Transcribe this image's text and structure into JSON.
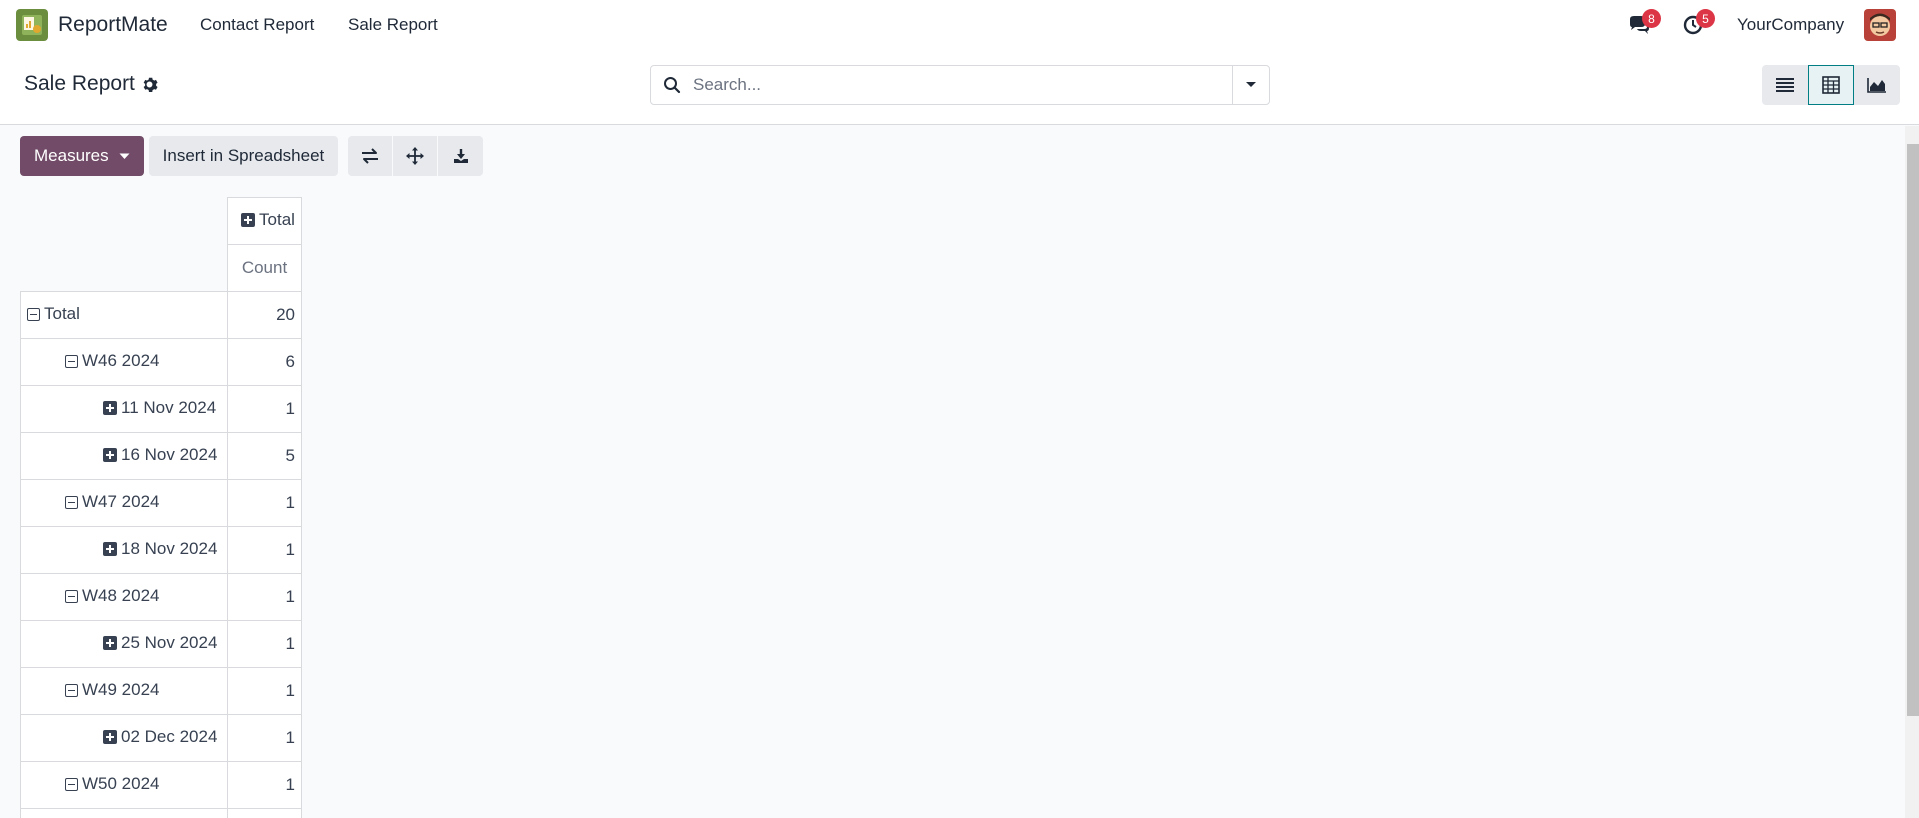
{
  "topbar": {
    "app_name": "ReportMate",
    "nav": [
      {
        "label": "Contact Report"
      },
      {
        "label": "Sale Report"
      }
    ],
    "messages_count": "8",
    "activities_count": "5",
    "company": "YourCompany"
  },
  "control_panel": {
    "title": "Sale Report",
    "search_placeholder": "Search...",
    "views": [
      "list-view",
      "pivot-view",
      "graph-view"
    ],
    "active_view": "pivot-view"
  },
  "toolbar": {
    "measures_label": "Measures",
    "insert_label": "Insert in Spreadsheet"
  },
  "pivot": {
    "col_header": "Total",
    "measure": "Count",
    "rows": [
      {
        "label": "Total",
        "value": "20",
        "level": 0,
        "expanded": true
      },
      {
        "label": "W46 2024",
        "value": "6",
        "level": 1,
        "expanded": true
      },
      {
        "label": "11 Nov 2024",
        "value": "1",
        "level": 2,
        "expanded": false
      },
      {
        "label": "16 Nov 2024",
        "value": "5",
        "level": 2,
        "expanded": false
      },
      {
        "label": "W47 2024",
        "value": "1",
        "level": 1,
        "expanded": true
      },
      {
        "label": "18 Nov 2024",
        "value": "1",
        "level": 2,
        "expanded": false
      },
      {
        "label": "W48 2024",
        "value": "1",
        "level": 1,
        "expanded": true
      },
      {
        "label": "25 Nov 2024",
        "value": "1",
        "level": 2,
        "expanded": false
      },
      {
        "label": "W49 2024",
        "value": "1",
        "level": 1,
        "expanded": true
      },
      {
        "label": "02 Dec 2024",
        "value": "1",
        "level": 2,
        "expanded": false
      },
      {
        "label": "W50 2024",
        "value": "1",
        "level": 1,
        "expanded": true
      }
    ]
  },
  "colors": {
    "primary": "#714b67",
    "accent": "#017e84",
    "badge": "#dc3545"
  }
}
